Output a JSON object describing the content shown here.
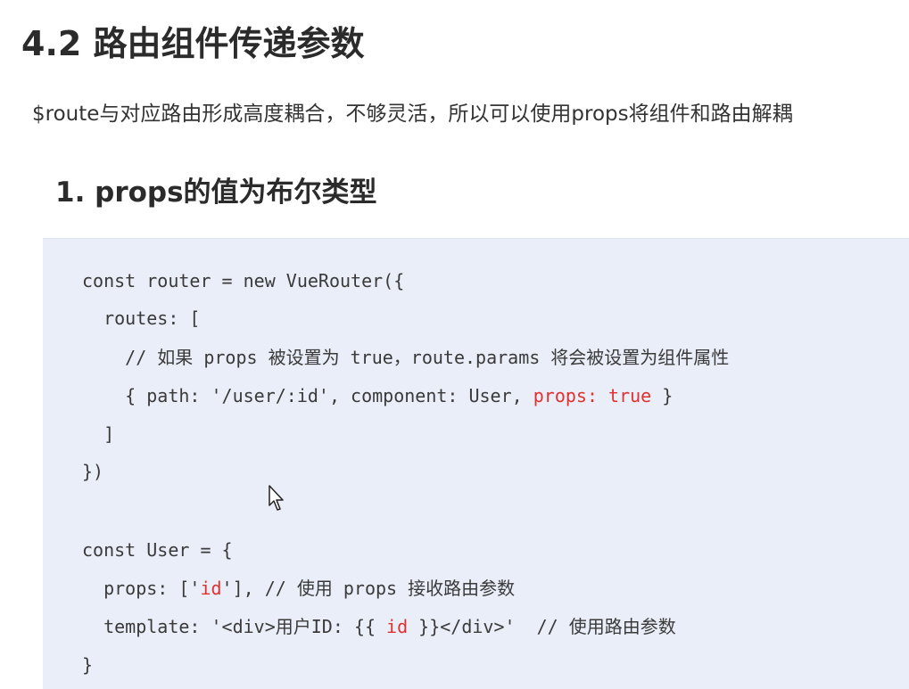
{
  "heading": "4.2 路由组件传递参数",
  "intro": "$route与对应路由形成高度耦合，不够灵活，所以可以使用props将组件和路由解耦",
  "subheading": "1. props的值为布尔类型",
  "code": {
    "line1": "const router = new VueRouter({",
    "line2": "  routes: [",
    "line3_a": "    // 如果 props 被设置为 true，route.params 将会被设置为组件属性",
    "line4_a": "    { path: '/user/:id', component: User, ",
    "line4_hl": "props: true",
    "line4_b": " }",
    "line5": "  ]",
    "line6": "})",
    "line7": "const User = {",
    "line8_a": "  props: ['",
    "line8_hl": "id",
    "line8_b": "'], // 使用 props 接收路由参数",
    "line9_a": "  template: '<div>用户ID: {{ ",
    "line9_hl": "id",
    "line9_b": " }}</div>'  // 使用路由参数",
    "line10": "}"
  },
  "colors": {
    "code_background": "#e9eef8",
    "highlight": "#e03131"
  },
  "icons": {
    "cursor": "mouse-pointer-icon"
  }
}
